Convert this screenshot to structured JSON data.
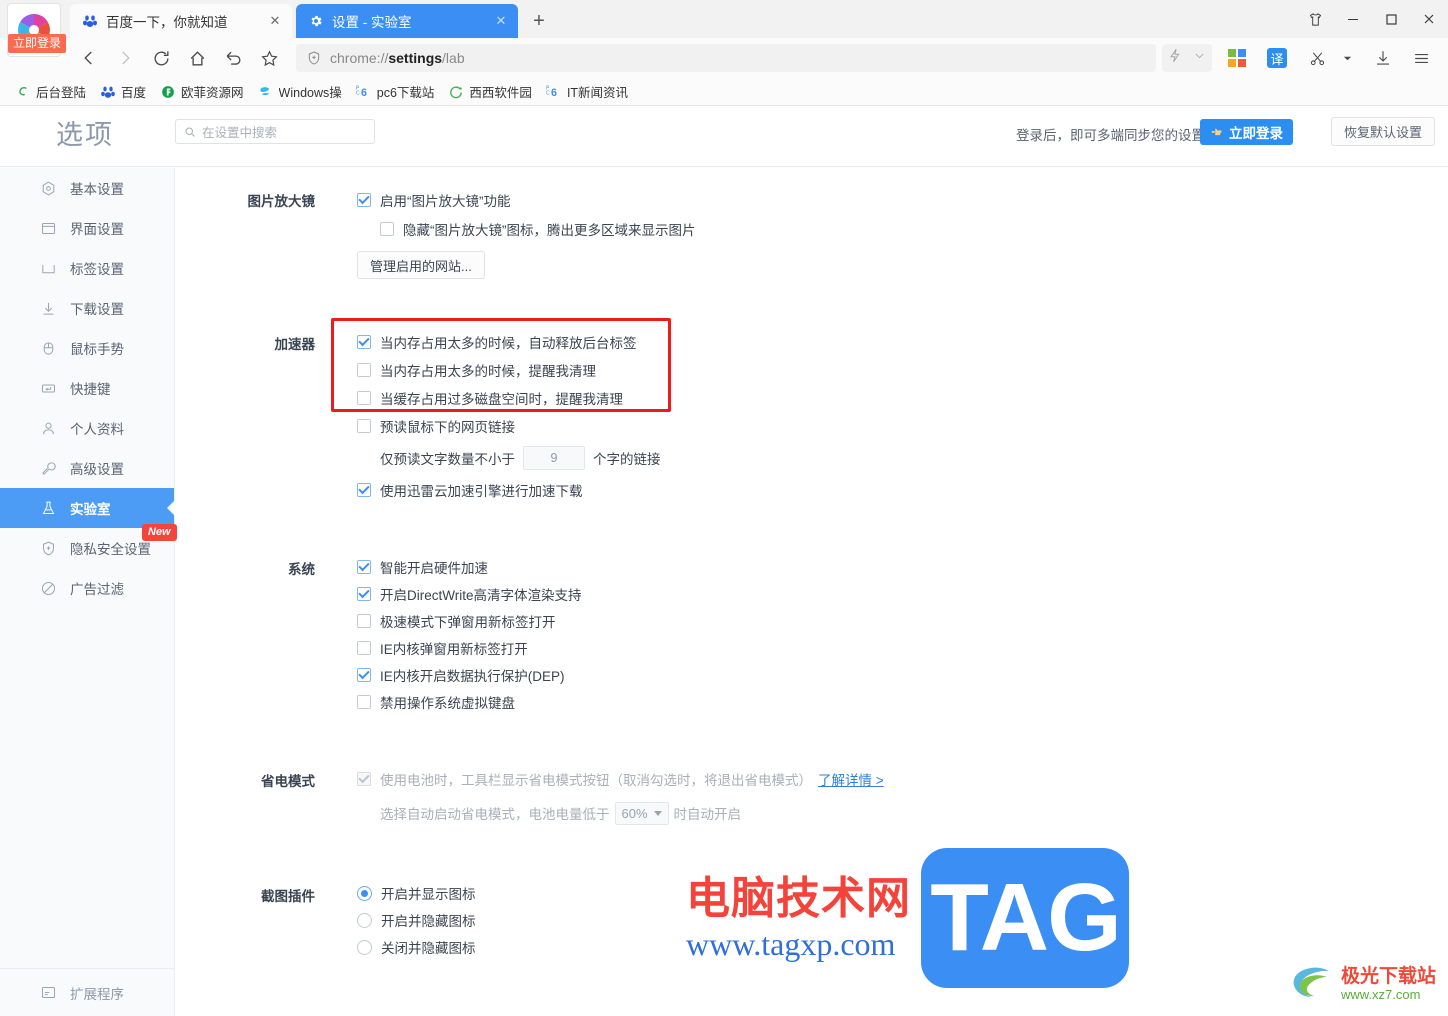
{
  "window": {
    "controls": [
      {
        "name": "theme",
        "icon": "tshirt-icon",
        "label": "皮肤"
      },
      {
        "name": "minimize",
        "icon": "minimize-icon",
        "label": "—"
      },
      {
        "name": "maximize",
        "icon": "maximize-icon",
        "label": "□"
      },
      {
        "name": "close",
        "icon": "close-icon",
        "label": "✕"
      }
    ]
  },
  "brand": {
    "logo_name": "360-browser-logo",
    "login_badge": "立即登录"
  },
  "tabs": [
    {
      "title": "百度一下，你就知道",
      "favicon": "baidu-favicon",
      "active": false,
      "close": "✕"
    },
    {
      "title": "设置 - 实验室",
      "favicon": "gear-icon",
      "active": true,
      "close": "✕"
    }
  ],
  "newtab_label": "+",
  "nav": {
    "back": "‹",
    "forward": "›",
    "reload": "⟳",
    "home": "⌂",
    "undo": "↺",
    "star": "☆",
    "address": {
      "prefix": "chrome://",
      "bold": "settings",
      "suffix": "/lab",
      "full": "chrome://settings/lab",
      "shield_icon": "shield-plus-icon"
    },
    "right_buttons": [
      {
        "name": "flash-icon",
        "label": "⚡"
      },
      {
        "name": "chevron-down-icon",
        "label": "⌄"
      },
      {
        "name": "windows-apps-icon",
        "label": ""
      },
      {
        "name": "translate-icon",
        "label": "译"
      },
      {
        "name": "scissors-icon",
        "label": "✂"
      },
      {
        "name": "scissors-caret-icon",
        "label": "▾"
      },
      {
        "name": "download-icon",
        "label": "⤓"
      },
      {
        "name": "menu-icon",
        "label": "☰"
      }
    ]
  },
  "bookmarks": [
    {
      "label": "后台登陆",
      "icon": "swirl-icon",
      "color": "#3aaa5e"
    },
    {
      "label": "百度",
      "icon": "baidu-favicon",
      "color": "#2b5fd9"
    },
    {
      "label": "欧菲资源网",
      "icon": "circle-f-icon",
      "color": "#12a14b"
    },
    {
      "label": "Windows操",
      "icon": "windows-icon",
      "color": "#3bb6e8"
    },
    {
      "label": "pc6下载站",
      "icon": "pc6-icon",
      "color": "#3b8ef3"
    },
    {
      "label": "西西软件园",
      "icon": "cc-icon",
      "color": "#4caf50"
    },
    {
      "label": "IT新闻资讯",
      "icon": "pc6-icon",
      "color": "#3b8ef3"
    }
  ],
  "settings_header": {
    "title": "选项",
    "search_placeholder": "在设置中搜索",
    "search_icon": "search-icon",
    "sync_text": "登录后，即可多端同步您的设置",
    "login_button": "立即登录",
    "login_button_icon": "pointing-hand-icon",
    "restore_button": "恢复默认设置"
  },
  "sidebar": {
    "items": [
      {
        "label": "基本设置",
        "icon": "hexagon-target-icon",
        "active": false
      },
      {
        "label": "界面设置",
        "icon": "window-icon",
        "active": false
      },
      {
        "label": "标签设置",
        "icon": "tab-icon",
        "active": false
      },
      {
        "label": "下载设置",
        "icon": "download-arrow-icon",
        "active": false
      },
      {
        "label": "鼠标手势",
        "icon": "mouse-icon",
        "active": false
      },
      {
        "label": "快捷键",
        "icon": "keyboard-key-icon",
        "active": false
      },
      {
        "label": "个人资料",
        "icon": "person-icon",
        "active": false
      },
      {
        "label": "高级设置",
        "icon": "wrench-icon",
        "active": false
      },
      {
        "label": "实验室",
        "icon": "flask-icon",
        "active": true
      },
      {
        "label": "隐私安全设置",
        "icon": "shield-plus-icon",
        "active": false
      },
      {
        "label": "广告过滤",
        "icon": "no-entry-icon",
        "active": false
      }
    ],
    "new_badge": "New",
    "bottom_item": {
      "label": "扩展程序",
      "icon": "extension-icon"
    }
  },
  "sections": [
    {
      "id": "image-magnifier",
      "label": "图片放大镜",
      "rows": [
        {
          "type": "checkbox",
          "checked": true,
          "label": "启用“图片放大镜”功能"
        },
        {
          "type": "checkbox",
          "checked": false,
          "label": "隐藏“图片放大镜”图标，腾出更多区域来显示图片",
          "indent": true
        },
        {
          "type": "button",
          "label": "管理启用的网站..."
        }
      ]
    },
    {
      "id": "accelerator",
      "label": "加速器",
      "rows": [
        {
          "type": "checkbox",
          "checked": true,
          "label": "当内存占用太多的时候，自动释放后台标签",
          "highlighted": true
        },
        {
          "type": "checkbox",
          "checked": false,
          "label": "当内存占用太多的时候，提醒我清理",
          "highlighted": true
        },
        {
          "type": "checkbox",
          "checked": false,
          "label": "当缓存占用过多磁盘空间时，提醒我清理",
          "highlighted": true
        },
        {
          "type": "checkbox",
          "checked": false,
          "label": "预读鼠标下的网页链接"
        },
        {
          "type": "inline-number",
          "prefix": "仅预读文字数量不小于",
          "value": "9",
          "suffix": "个字的链接"
        },
        {
          "type": "checkbox",
          "checked": true,
          "label": "使用迅雷云加速引擎进行加速下载"
        }
      ]
    },
    {
      "id": "system",
      "label": "系统",
      "rows": [
        {
          "type": "checkbox",
          "checked": true,
          "label": "智能开启硬件加速"
        },
        {
          "type": "checkbox",
          "checked": true,
          "label": "开启DirectWrite高清字体渲染支持"
        },
        {
          "type": "checkbox",
          "checked": false,
          "label": "极速模式下弹窗用新标签打开"
        },
        {
          "type": "checkbox",
          "checked": false,
          "label": "IE内核弹窗用新标签打开"
        },
        {
          "type": "checkbox",
          "checked": true,
          "label": "IE内核开启数据执行保护(DEP)"
        },
        {
          "type": "checkbox",
          "checked": false,
          "label": "禁用操作系统虚拟键盘"
        }
      ]
    },
    {
      "id": "power-save",
      "label": "省电模式",
      "rows": [
        {
          "type": "checkbox-disabled",
          "checked": true,
          "label": "使用电池时，工具栏显示省电模式按钮（取消勾选时，将退出省电模式）",
          "link": "了解详情 >"
        },
        {
          "type": "inline-select",
          "prefix": "选择自动启动省电模式，电池电量低于",
          "value": "60%",
          "suffix": "时自动开启"
        }
      ]
    },
    {
      "id": "screenshot-plugin",
      "label": "截图插件",
      "rows": [
        {
          "type": "radio",
          "checked": true,
          "label": "开启并显示图标"
        },
        {
          "type": "radio",
          "checked": false,
          "label": "开启并隐藏图标"
        },
        {
          "type": "radio",
          "checked": false,
          "label": "关闭并隐藏图标"
        }
      ]
    }
  ],
  "watermarks": {
    "main_cn": "电脑技术网",
    "main_url": "www.tagxp.com",
    "main_tag": "TAG",
    "corner_cn": "极光下载站",
    "corner_url": "www.xz7.com"
  },
  "colors": {
    "accent": "#3b8ef3",
    "sidebar_active": "#4c9bf5",
    "highlight_box": "#ee1b18",
    "badge_red": "#f5433d",
    "login_badge": "#fa6a50"
  }
}
